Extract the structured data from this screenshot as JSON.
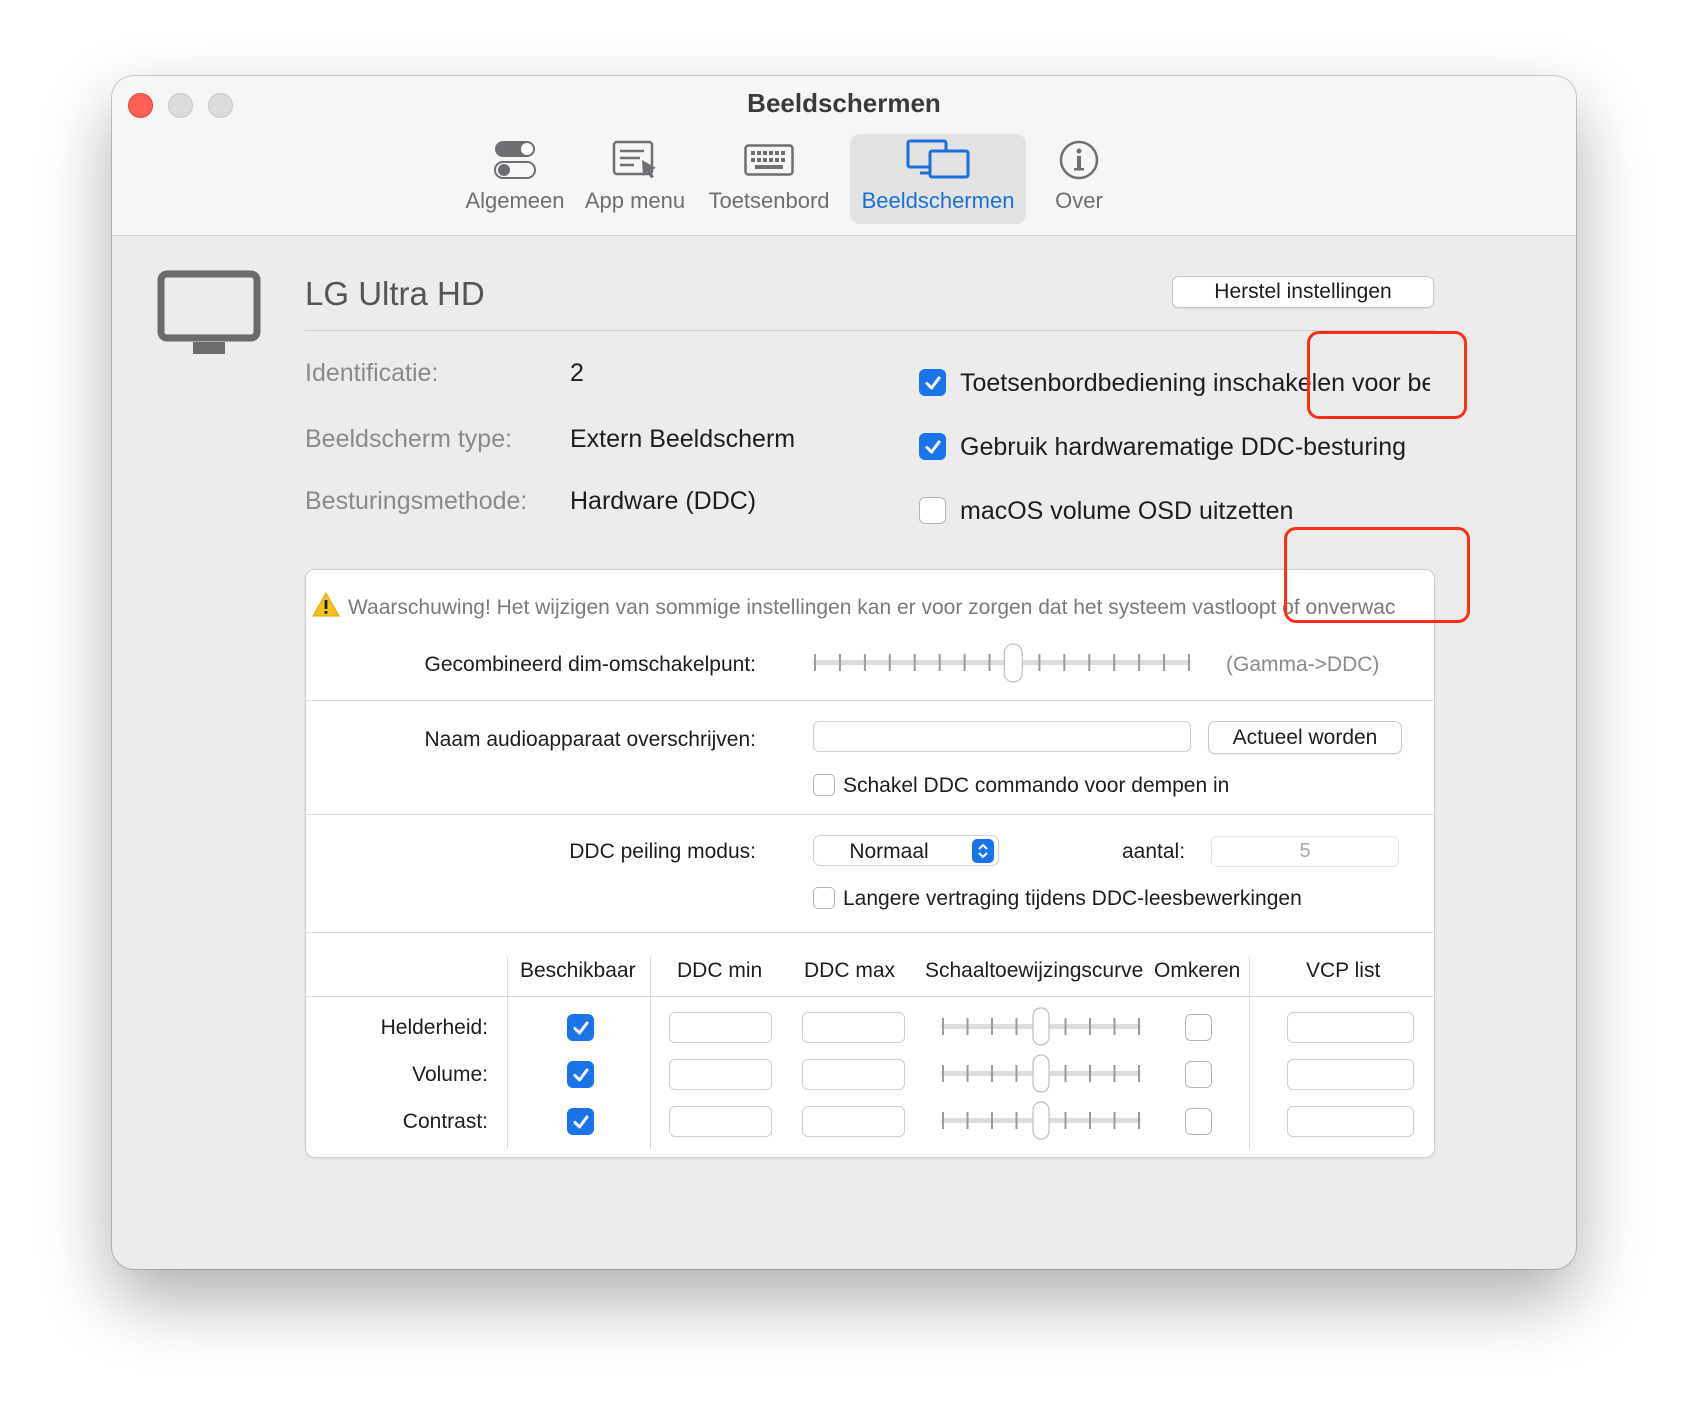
{
  "window": {
    "title": "Beeldschermen"
  },
  "toolbar": {
    "items": [
      {
        "label": "Algemeen",
        "icon": "toggles-icon"
      },
      {
        "label": "App menu",
        "icon": "app-menu-icon"
      },
      {
        "label": "Toetsenbord",
        "icon": "keyboard-icon"
      },
      {
        "label": "Beeldschermen",
        "icon": "displays-icon",
        "active": true
      },
      {
        "label": "Over",
        "icon": "info-icon"
      }
    ]
  },
  "display": {
    "name": "LG Ultra HD",
    "reset_button": "Herstel instellingen",
    "info": {
      "id_label": "Identificatie:",
      "id_value": "2",
      "type_label": "Beeldscherm type:",
      "type_value": "Extern Beeldscherm",
      "method_label": "Besturingsmethode:",
      "method_value": "Hardware (DDC)"
    },
    "options": [
      {
        "label": "Toetsenbordbediening inschakelen voor beeld:",
        "checked": true
      },
      {
        "label": "Gebruik hardwarematige DDC-besturing",
        "checked": true
      },
      {
        "label": "macOS volume OSD uitzetten",
        "checked": false
      }
    ]
  },
  "advanced": {
    "warning": "Waarschuwing! Het wijzigen van sommige instellingen kan er voor zorgen dat het systeem vastloopt of onverwac",
    "dim_label": "Gecombineerd dim-omschakelpunt:",
    "dim_note": "(Gamma->DDC)",
    "dim_value": 0.53,
    "audio_label": "Naam audioapparaat overschrijven:",
    "audio_value": "",
    "audio_button": "Actueel worden",
    "mute_label": "Schakel DDC commando voor dempen in",
    "mute_checked": false,
    "poll_label": "DDC peiling modus:",
    "poll_value": "Normaal",
    "count_label": "aantal:",
    "count_value": "5",
    "delay_label": "Langere vertraging tijdens DDC-leesbewerkingen",
    "delay_checked": false,
    "table": {
      "headers": [
        "Beschikbaar",
        "DDC min",
        "DDC max",
        "Schaaltoewijzingscurve",
        "Omkeren",
        "VCP list"
      ],
      "rows": [
        {
          "label": "Helderheid:",
          "available": true,
          "curve": 0.5,
          "invert": false
        },
        {
          "label": "Volume:",
          "available": true,
          "curve": 0.5,
          "invert": false
        },
        {
          "label": "Contrast:",
          "available": true,
          "curve": 0.5,
          "invert": false
        }
      ]
    }
  },
  "colors": {
    "accent": "#1a73e8",
    "annotation": "#ff2d1a",
    "warning": "#f5c518"
  }
}
